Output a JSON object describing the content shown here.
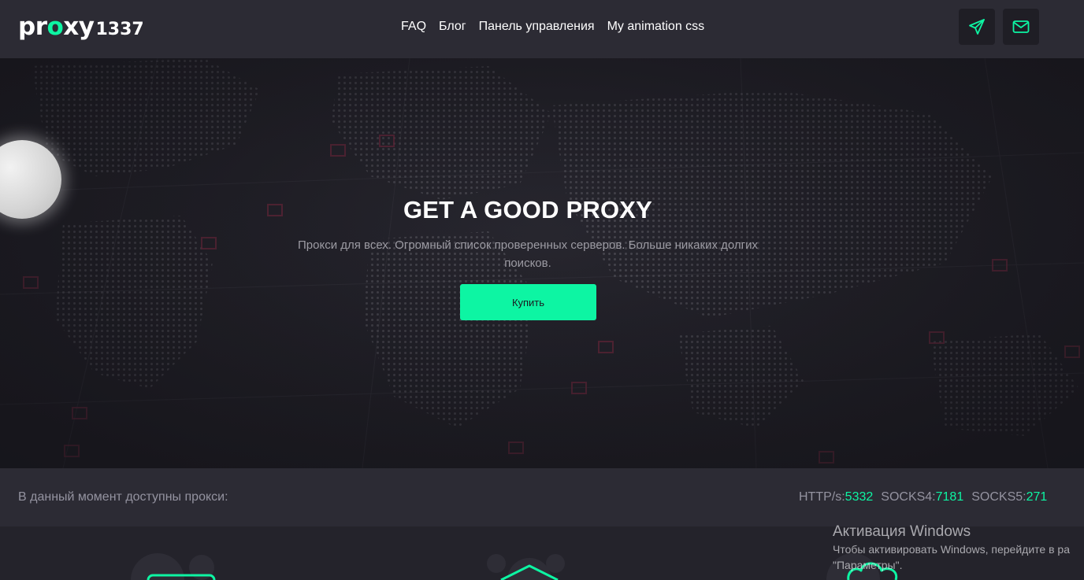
{
  "header": {
    "logo": {
      "word_start": "pr",
      "word_accent": "o",
      "word_end": "xy",
      "number": "1337"
    },
    "nav": [
      {
        "label": "FAQ"
      },
      {
        "label": "Блог"
      },
      {
        "label": "Панель управления"
      },
      {
        "label": "My animation css"
      }
    ],
    "icons": {
      "telegram": "paper-plane-icon",
      "mail": "envelope-icon"
    }
  },
  "hero": {
    "title": "GET A GOOD PROXY",
    "subtitle": "Прокси для всех. Огромный список проверенных серверов. Больше никаких долгих поисков.",
    "button_label": "Купить"
  },
  "stats": {
    "label": "В данный момент доступны прокси:",
    "http_label": "HTTP/s:",
    "http_value": "5332",
    "socks4_label": "SOCKS4:",
    "socks4_value": "7181",
    "socks5_label": "SOCKS5:",
    "socks5_value": "271"
  },
  "watermark": {
    "title": "Активация Windows",
    "line1": "Чтобы активировать Windows, перейдите в ра",
    "line2": "\"Параметры\"."
  },
  "colors": {
    "accent": "#0df5a3",
    "header_bg": "#2c2b34",
    "page_bg": "#24232b",
    "muted_text": "#9493a0"
  }
}
